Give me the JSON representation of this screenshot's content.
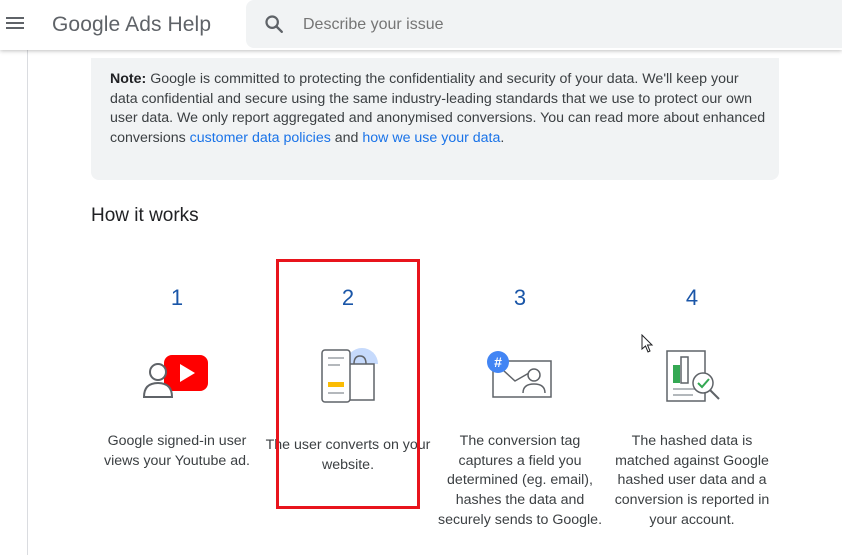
{
  "header": {
    "title": "Google Ads Help",
    "search_placeholder": "Describe your issue"
  },
  "note": {
    "label": "Note:",
    "text_before": " Google is committed to protecting the confidentiality and security of your data. We'll keep your data confidential and secure using the same industry-leading standards that we use to protect our own user data. We only report aggregated and anonymised conversions. You can read more about enhanced conversions ",
    "link1": "customer data policies",
    "text_mid": " and ",
    "link2": "how we use your data",
    "text_end": "."
  },
  "section": {
    "title": "How it works"
  },
  "steps": [
    {
      "number": "1",
      "text": "Google signed-in user views your Youtube ad.",
      "icon": "youtube-ad-icon"
    },
    {
      "number": "2",
      "text": "The user converts on your website.",
      "icon": "phone-conversion-icon"
    },
    {
      "number": "3",
      "text": "The conversion tag captures a field you determined (eg. email), hashes the data and securely sends to Google.",
      "icon": "email-hash-icon"
    },
    {
      "number": "4",
      "text": "The hashed data is matched against Google hashed user data and a conversion is reported in your account.",
      "icon": "report-match-icon"
    }
  ],
  "colors": {
    "accent": "#1a73e8",
    "step_number": "#1a56a8",
    "highlight": "#e8141c",
    "youtube": "#ff0000"
  }
}
